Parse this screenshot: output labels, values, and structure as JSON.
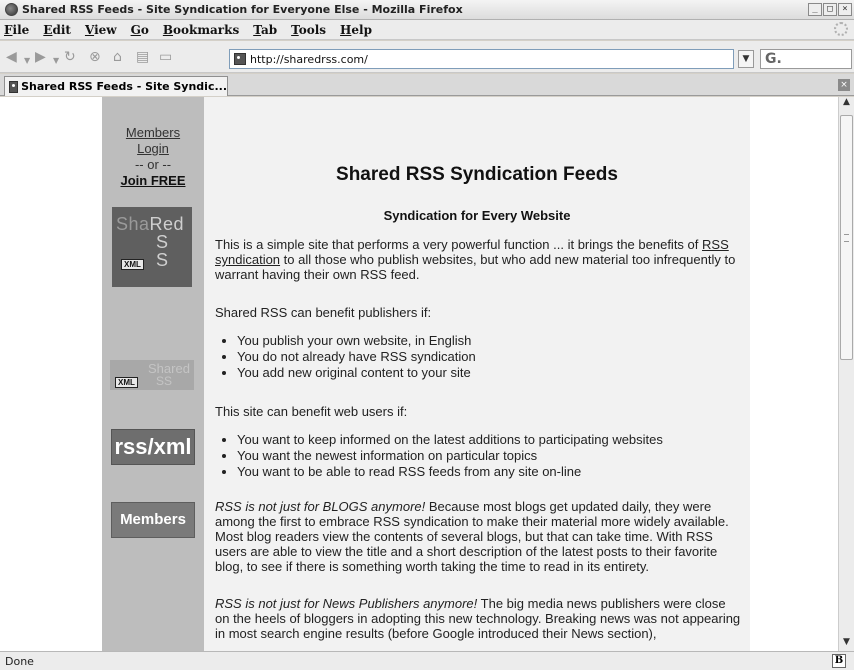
{
  "window": {
    "title": "Shared RSS Feeds - Site Syndication for Everyone Else - Mozilla Firefox",
    "controls": [
      "minimize",
      "maximize",
      "close"
    ]
  },
  "menu": [
    "File",
    "Edit",
    "View",
    "Go",
    "Bookmarks",
    "Tab",
    "Tools",
    "Help"
  ],
  "toolbar": {
    "url": "http://sharedrss.com/",
    "search_engine_label": "G.",
    "icons": [
      "back-icon",
      "forward-icon",
      "reload-icon",
      "stop-icon",
      "home-icon",
      "print-icon",
      "new-tab-icon"
    ]
  },
  "tab": {
    "label": "Shared RSS Feeds - Site Syndic..."
  },
  "sidebar": {
    "members_link": "Members",
    "login_link": "Login",
    "or_text": "-- or --",
    "join_link": "Join FREE",
    "logo_big": {
      "line1a": "Sha",
      "line1b": "Red",
      "line2": "S",
      "line3": "S",
      "badge": "XML"
    },
    "logo_small": {
      "text1": "Shared",
      "text2": "SS",
      "badge": "XML"
    },
    "rss_button": "rss/xml",
    "members_button": "Members"
  },
  "main": {
    "title": "Shared RSS Syndication Feeds",
    "subtitle": "Syndication for Every Website",
    "intro_before": "This is a simple site that performs a very powerful function ... it brings the benefits of",
    "intro_link": "RSS syndication",
    "intro_after": "to all those who publish websites, but who add new material too infrequently to warrant having their own RSS feed.",
    "publishers_heading": "Shared RSS can benefit publishers if:",
    "publishers_list": [
      "You publish your own website, in English",
      "You do not already have RSS syndication",
      "You add new original content to your site"
    ],
    "users_heading": "This site can benefit web users if:",
    "users_list": [
      "You want to keep informed on the latest additions to participating websites",
      "You want the newest information on particular topics",
      "You want to be able to read RSS feeds from any site on-line"
    ],
    "blogs_italic": "RSS is not just for BLOGS anymore!",
    "blogs_text": "Because most blogs get updated daily, they were among the first to embrace RSS syndication to make their material more widely available. Most blog readers view the contents of several blogs, but that can take time. With RSS users are able to view the title and a short description of the latest posts to their favorite blog, to see if there is something worth taking the time to read in its entirety.",
    "news_italic": "RSS is not just for News Publishers anymore!",
    "news_text": "The big media news publishers were close on the heels of bloggers in adopting this new technology. Breaking news was not appearing in most search engine results (before Google introduced their News section),"
  },
  "status": {
    "text": "Done",
    "badge": "B"
  }
}
